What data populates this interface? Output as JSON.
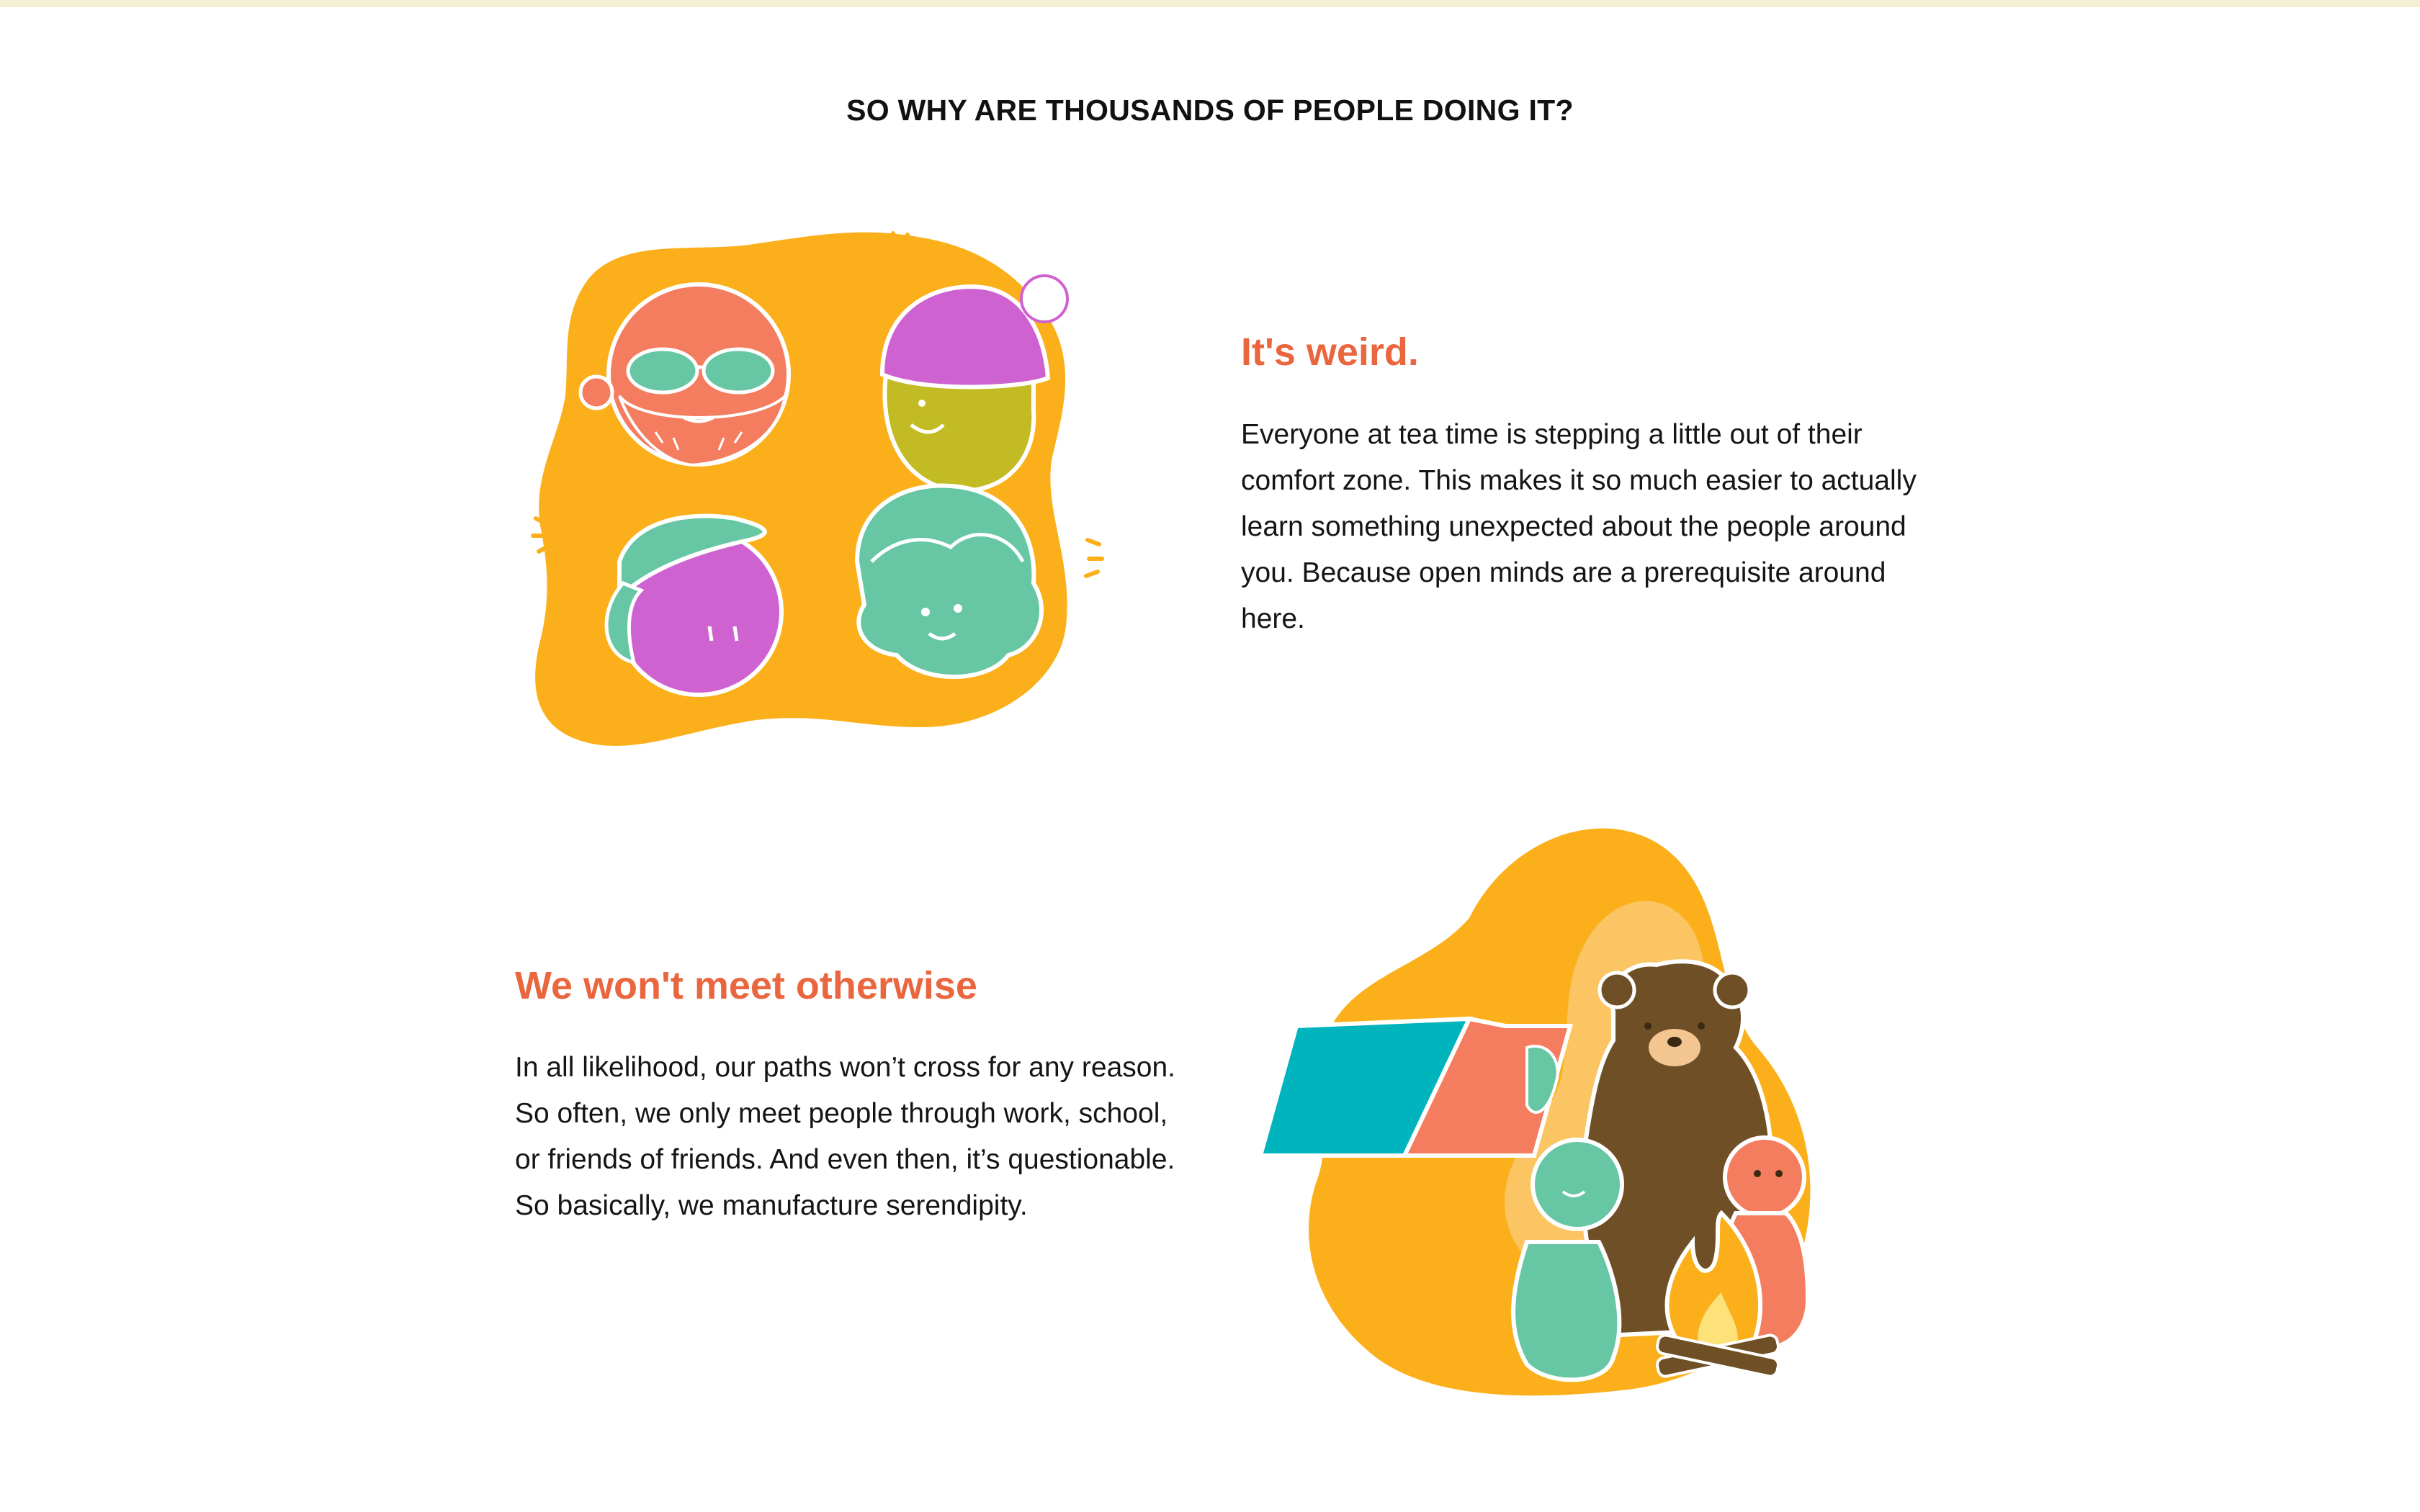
{
  "header": {
    "title": "SO WHY ARE THOUSANDS OF PEOPLE DOING IT?"
  },
  "reasons": [
    {
      "heading": "It's weird.",
      "body": "Everyone at tea time is stepping a little out of their comfort zone. This makes it so much easier to actually learn something unexpected about the people around you. Because open minds are a prerequisite around here.",
      "illustration": "four-faces-illustration"
    },
    {
      "heading": "We won't meet otherwise",
      "body": "In all likelihood, our paths won’t cross for any reason. So often, we only meet people through work, school, or friends of friends. And even then, it’s questionable. So basically, we manufacture serendipity.",
      "illustration": "campfire-bear-illustration"
    }
  ],
  "colors": {
    "accent": "#e9663f",
    "blob": "#fbb01b",
    "coral": "#f47c5f",
    "mint": "#67c6a4",
    "purple": "#cf62d1",
    "olive": "#c2bb23",
    "teal": "#00b4bd",
    "bear": "#6f5026"
  }
}
